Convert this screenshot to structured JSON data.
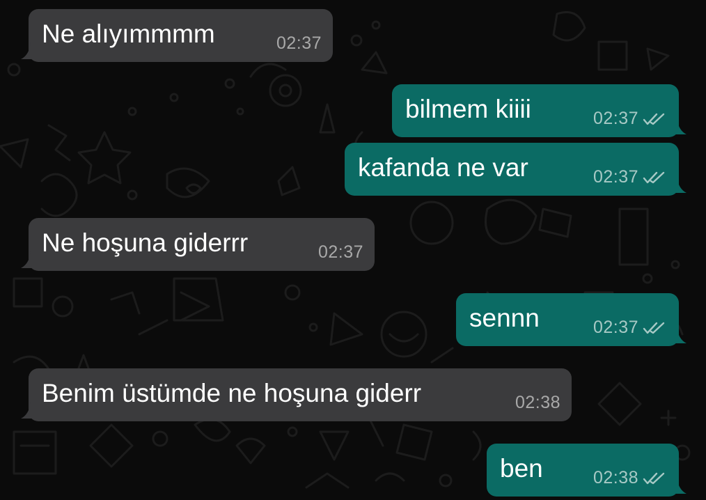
{
  "colors": {
    "background": "#0b0b0b",
    "incoming_bubble": "#3b3b3d",
    "outgoing_bubble": "#0b6b64",
    "incoming_time": "#a9a9a9",
    "outgoing_time": "#a7c9c5",
    "read_ticks": "#a7c9c5"
  },
  "icons": {
    "status": "double-check-icon"
  },
  "messages": [
    {
      "direction": "incoming",
      "text": "Ne alıyımmmm",
      "time": "02:37"
    },
    {
      "direction": "outgoing",
      "text": "bilmem kiiii",
      "time": "02:37",
      "status": "read"
    },
    {
      "direction": "outgoing",
      "text": "kafanda ne var",
      "time": "02:37",
      "status": "read"
    },
    {
      "direction": "incoming",
      "text": "Ne hoşuna giderrr",
      "time": "02:37"
    },
    {
      "direction": "outgoing",
      "text": "sennn",
      "time": "02:37",
      "status": "read"
    },
    {
      "direction": "incoming",
      "text": "Benim üstümde ne hoşuna giderr",
      "time": "02:38"
    },
    {
      "direction": "outgoing",
      "text": "ben",
      "time": "02:38",
      "status": "read"
    }
  ]
}
